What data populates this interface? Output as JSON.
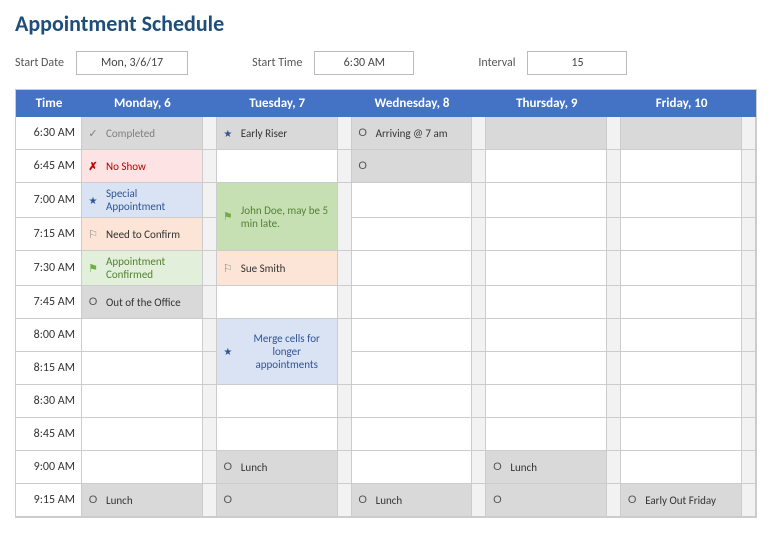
{
  "title": "Appointment Schedule",
  "controls": {
    "start_date_label": "Start Date",
    "start_date_value": "Mon, 3/6/17",
    "start_time_label": "Start Time",
    "start_time_value": "6:30 AM",
    "interval_label": "Interval",
    "interval_value": "15"
  },
  "header": {
    "time": "Time",
    "days": [
      "Monday, 6",
      "Tuesday, 7",
      "Wednesday, 8",
      "Thursday, 9",
      "Friday, 10"
    ]
  },
  "times": [
    "6:30 AM",
    "6:45 AM",
    "7:00 AM",
    "7:15 AM",
    "7:30 AM",
    "7:45 AM",
    "8:00 AM",
    "8:15 AM",
    "8:30 AM",
    "8:45 AM",
    "9:00 AM",
    "9:15 AM"
  ],
  "mon": {
    "r0": "Completed",
    "r1": "No Show",
    "r2": "Special Appointment",
    "r3": "Need to Confirm",
    "r4": "Appointment Confirmed",
    "r5": "Out of the Office",
    "r11": "Lunch"
  },
  "tue": {
    "r0": "Early Riser",
    "r2": "John Doe, may be 5 min late.",
    "r4": "Sue Smith",
    "r6": "Merge cells for longer appointments",
    "r10": "Lunch"
  },
  "wed": {
    "r0": "Arriving @ 7 am",
    "r11": "Lunch"
  },
  "thu": {
    "r10": "Lunch"
  },
  "fri": {
    "r11": "Early Out Friday"
  }
}
